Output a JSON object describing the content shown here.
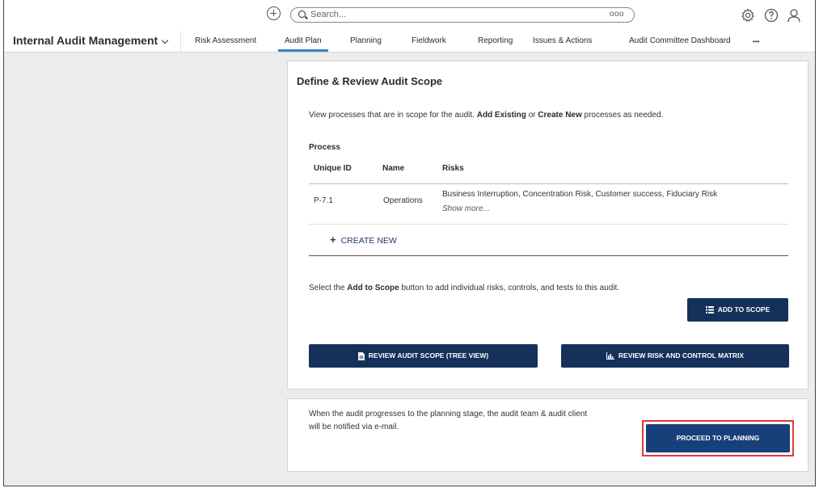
{
  "topbar": {
    "search_placeholder": "Search...",
    "search_more": "ooo"
  },
  "nav": {
    "module": "Internal Audit Management",
    "tabs": [
      {
        "label": "Risk Assessment"
      },
      {
        "label": "Audit Plan",
        "active": true
      },
      {
        "label": "Planning"
      },
      {
        "label": "Fieldwork"
      },
      {
        "label": "Reporting"
      },
      {
        "label": "Issues & Actions"
      },
      {
        "label": "Audit Committee Dashboard"
      },
      {
        "label": "•••"
      }
    ]
  },
  "scope_card": {
    "title": "Define & Review Audit Scope",
    "description": {
      "part1": "View processes that are in scope for the audit. ",
      "add_existing": "Add Existing",
      "part2": " or ",
      "create_new": "Create New",
      "part3": " processes as needed."
    },
    "process_heading": "Process",
    "table": {
      "headers": [
        "Unique ID",
        "Name",
        "Risks"
      ],
      "rows": [
        {
          "unique_id": "P-7.1",
          "name": "Operations",
          "risks": "Business Interruption, Concentration Risk, Customer success, Fiduciary Risk",
          "show_more": "Show more..."
        }
      ]
    },
    "create_new_label": "CREATE NEW",
    "scope_instruction": {
      "part1": "Select the ",
      "add_to_scope": "Add to Scope",
      "part2": " button to add individual risks, controls, and tests to this audit."
    },
    "add_to_scope_button": "ADD TO SCOPE",
    "review_tree_button": "REVIEW AUDIT SCOPE (TREE VIEW)",
    "review_matrix_button": "REVIEW RISK AND CONTROL MATRIX"
  },
  "planning_card": {
    "note_line1": "When the audit progresses to the planning stage, the audit team & audit client",
    "note_line2": "will be notified via e-mail.",
    "proceed_button": "PROCEED TO PLANNING"
  },
  "colors": {
    "button_navy": "#15305a",
    "active_tab_underline": "#3b82c4",
    "highlight_red": "#e03a3a"
  },
  "icons": [
    "plus-circle-icon",
    "search-icon",
    "gear-icon",
    "help-icon",
    "user-icon",
    "chevron-down-icon",
    "list-icon",
    "document-icon",
    "chart-icon"
  ]
}
